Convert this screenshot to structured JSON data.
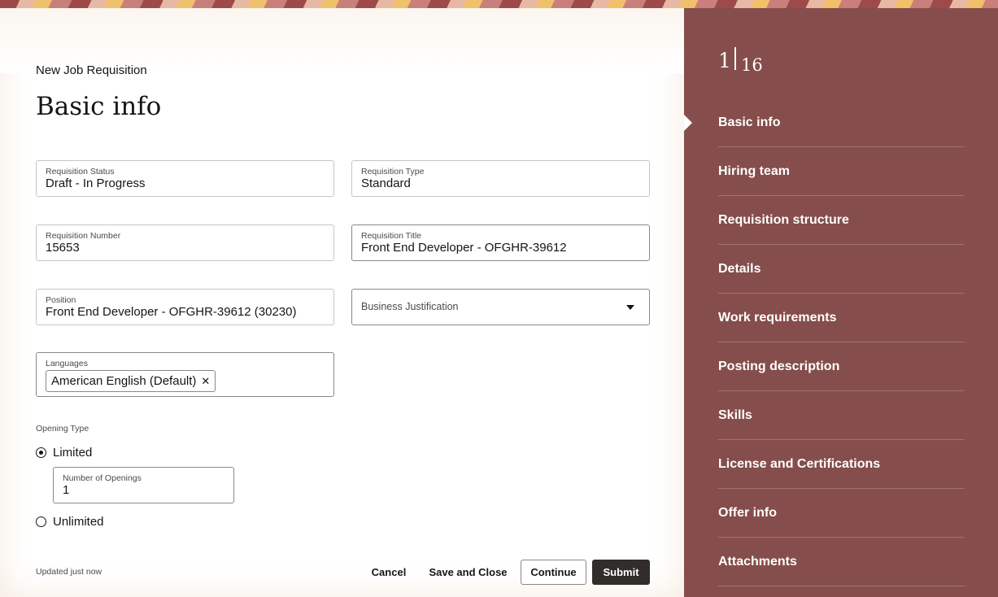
{
  "breadcrumb": "New Job Requisition",
  "page_title": "Basic info",
  "fields": {
    "requisition_status": {
      "label": "Requisition Status",
      "value": "Draft - In Progress"
    },
    "requisition_type": {
      "label": "Requisition Type",
      "value": "Standard"
    },
    "requisition_number": {
      "label": "Requisition Number",
      "value": "15653"
    },
    "requisition_title": {
      "label": "Requisition Title",
      "value": "Front End Developer - OFGHR-39612"
    },
    "position": {
      "label": "Position",
      "value": "Front End Developer - OFGHR-39612 (30230)"
    },
    "business_justification": {
      "placeholder": "Business Justification"
    },
    "languages": {
      "label": "Languages",
      "chips": [
        "American English (Default)"
      ]
    },
    "number_of_openings": {
      "label": "Number of Openings",
      "value": "1"
    }
  },
  "opening_type": {
    "label": "Opening Type",
    "options": [
      {
        "label": "Limited",
        "selected": true
      },
      {
        "label": "Unlimited",
        "selected": false
      }
    ]
  },
  "footer": {
    "status": "Updated just now",
    "cancel": "Cancel",
    "save_and_close": "Save and Close",
    "continue": "Continue",
    "submit": "Submit"
  },
  "steps": {
    "current": "1",
    "total": "16",
    "items": [
      "Basic info",
      "Hiring team",
      "Requisition structure",
      "Details",
      "Work requirements",
      "Posting description",
      "Skills",
      "License and Certifications",
      "Offer info",
      "Attachments"
    ]
  },
  "colors": {
    "sidebar": "#854d4b",
    "primary_button": "#312d2a"
  }
}
